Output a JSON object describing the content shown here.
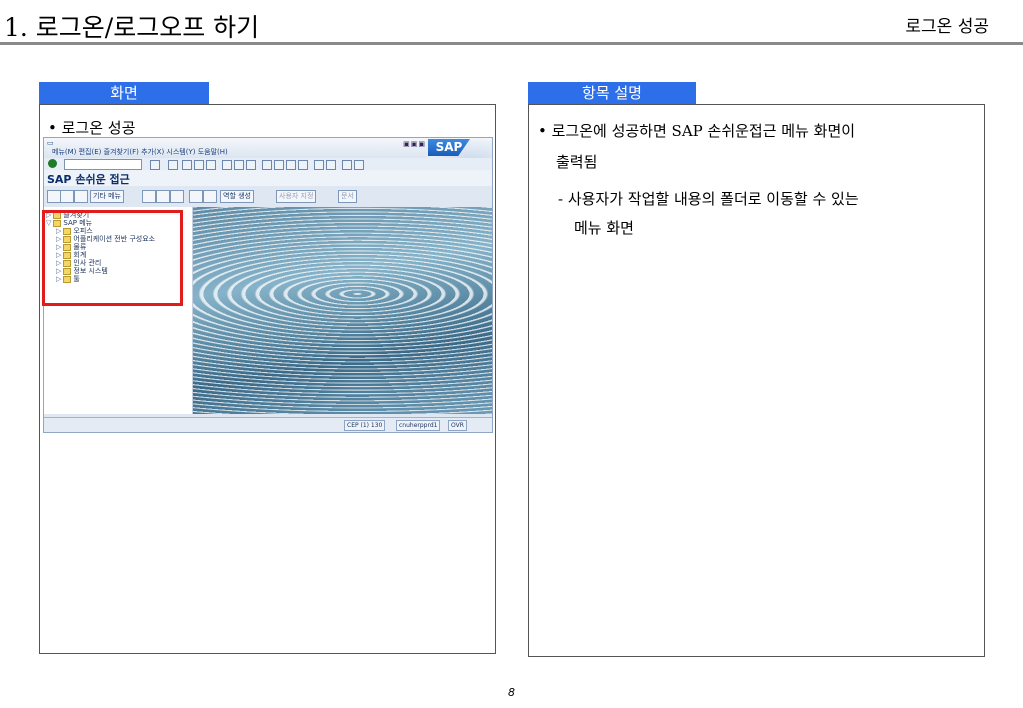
{
  "header": {
    "title": "1. 로그온/로그오프 하기",
    "right_label": "로그온 성공"
  },
  "left_panel": {
    "tab_label": "화면",
    "bullet": "• 로그온 성공",
    "sap": {
      "menubar": "메뉴(M)  편집(E)  즐겨찾기(F)  추가(X)  시스템(Y)  도움말(H)",
      "logo": "SAP",
      "title": "SAP 손쉬운 접근",
      "app_buttons": [
        "기타 메뉴",
        "역할 생성",
        "사용자 지정",
        "문서"
      ],
      "tree": [
        "즐겨찾기",
        "SAP 메뉴",
        "오피스",
        "어플리케이션 전반 구성요소",
        "물류",
        "회계",
        "인사 관리",
        "정보 시스템",
        "툴"
      ],
      "status": {
        "system": "CEP (1) 130",
        "server": "cnuherpprd1",
        "mode": "OVR"
      }
    }
  },
  "right_panel": {
    "tab_label": "항목 설명",
    "lines": [
      "• 로그온에 성공하면 SAP 손쉬운접근 메뉴 화면이",
      "출력됨",
      "- 사용자가 작업할 내용의 폴더로 이동할 수 있는",
      "메뉴 화면"
    ]
  },
  "page_number": "8"
}
